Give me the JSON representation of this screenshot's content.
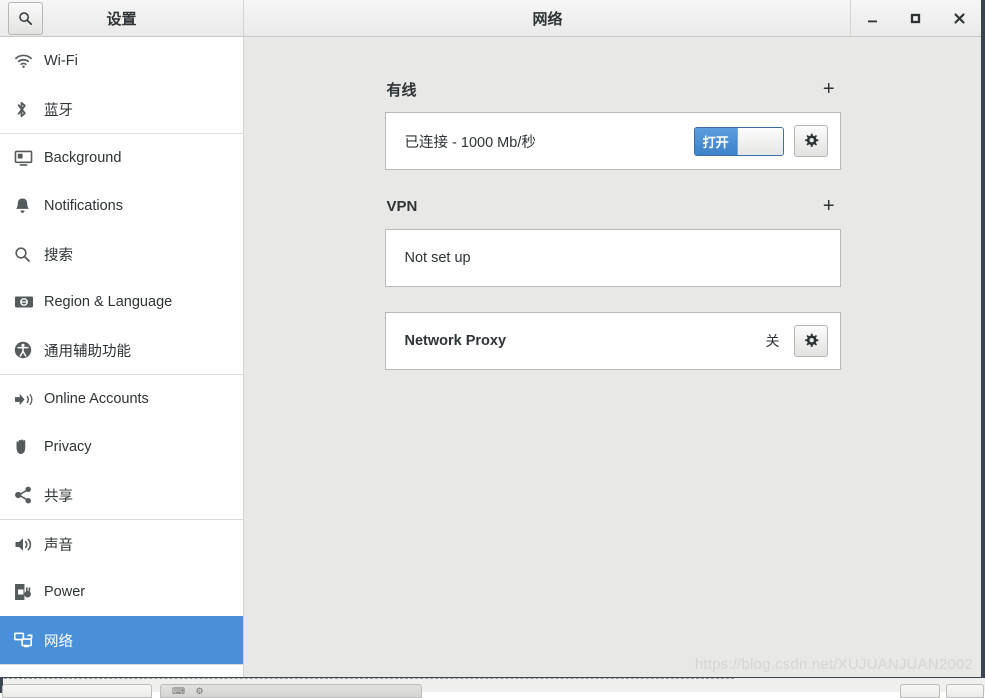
{
  "window": {
    "settings_title": "设置",
    "page_title": "网络",
    "search_icon": "search-icon",
    "controls": {
      "minimize": "_",
      "maximize": "□",
      "close": "✕"
    }
  },
  "sidebar": {
    "groups": [
      {
        "items": [
          {
            "icon": "wifi-icon",
            "label": "Wi-Fi",
            "selected": false
          },
          {
            "icon": "bluetooth-icon",
            "label": "蓝牙",
            "selected": false
          }
        ]
      },
      {
        "items": [
          {
            "icon": "background-icon",
            "label": "Background",
            "selected": false
          },
          {
            "icon": "bell-icon",
            "label": "Notifications",
            "selected": false
          },
          {
            "icon": "search-icon",
            "label": "搜索",
            "selected": false
          },
          {
            "icon": "region-language-icon",
            "label": "Region & Language",
            "selected": false
          },
          {
            "icon": "accessibility-icon",
            "label": "通用辅助功能",
            "selected": false
          }
        ]
      },
      {
        "items": [
          {
            "icon": "online-accounts-icon",
            "label": "Online Accounts",
            "selected": false
          },
          {
            "icon": "privacy-hand-icon",
            "label": "Privacy",
            "selected": false
          },
          {
            "icon": "share-icon",
            "label": "共享",
            "selected": false
          }
        ]
      },
      {
        "items": [
          {
            "icon": "sound-icon",
            "label": "声音",
            "selected": false
          },
          {
            "icon": "power-icon",
            "label": "Power",
            "selected": false
          },
          {
            "icon": "network-icon",
            "label": "网络",
            "selected": true
          }
        ]
      }
    ]
  },
  "main": {
    "wired": {
      "section_title": "有线",
      "add_label": "+",
      "status_text": "已连接 - 1000 Mb/秒",
      "toggle_label": "打开",
      "toggle_state": "on",
      "settings_icon": "gear-icon"
    },
    "vpn": {
      "section_title": "VPN",
      "add_label": "+",
      "status_text": "Not set up"
    },
    "proxy": {
      "label": "Network Proxy",
      "status_text": "关",
      "settings_icon": "gear-icon"
    },
    "watermark": "https://blog.csdn.net/XUJUANJUAN2002"
  },
  "colors": {
    "accent": "#4a90d9",
    "panel_bg": "#e8e8e6",
    "card_bg": "#ffffff",
    "text": "#2e3436",
    "window_border": "#3b4551"
  }
}
